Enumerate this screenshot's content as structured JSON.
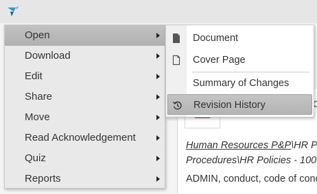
{
  "background": {
    "path_link": "Human Resources P&P",
    "path_rest_1": "\\HR P",
    "path_line_2": "Procedures\\HR Policies - 100",
    "keywords": "ADMIN, conduct, code of cond",
    "peek_char": "C"
  },
  "context_menu": {
    "items": [
      {
        "label": "Open",
        "has_submenu": true,
        "active": true
      },
      {
        "label": "Download",
        "has_submenu": true
      },
      {
        "label": "Edit",
        "has_submenu": true
      },
      {
        "label": "Share",
        "has_submenu": true
      },
      {
        "label": "Move",
        "has_submenu": true
      },
      {
        "label": "Read Acknowledgement",
        "has_submenu": true
      },
      {
        "label": "Quiz",
        "has_submenu": true
      },
      {
        "label": "Reports",
        "has_submenu": true
      }
    ]
  },
  "submenu": {
    "items": [
      {
        "label": "Document",
        "icon": "document-icon"
      },
      {
        "label": "Cover Page",
        "icon": "cover-page-icon"
      },
      {
        "label": "Summary of Changes",
        "icon": ""
      },
      {
        "label": "Revision History",
        "icon": "history-icon",
        "active": true
      }
    ]
  },
  "colors": {
    "pdf_red": "#c0332b",
    "menu_bg": "#e9e9e9",
    "active_bg": "#b8b8b8"
  }
}
